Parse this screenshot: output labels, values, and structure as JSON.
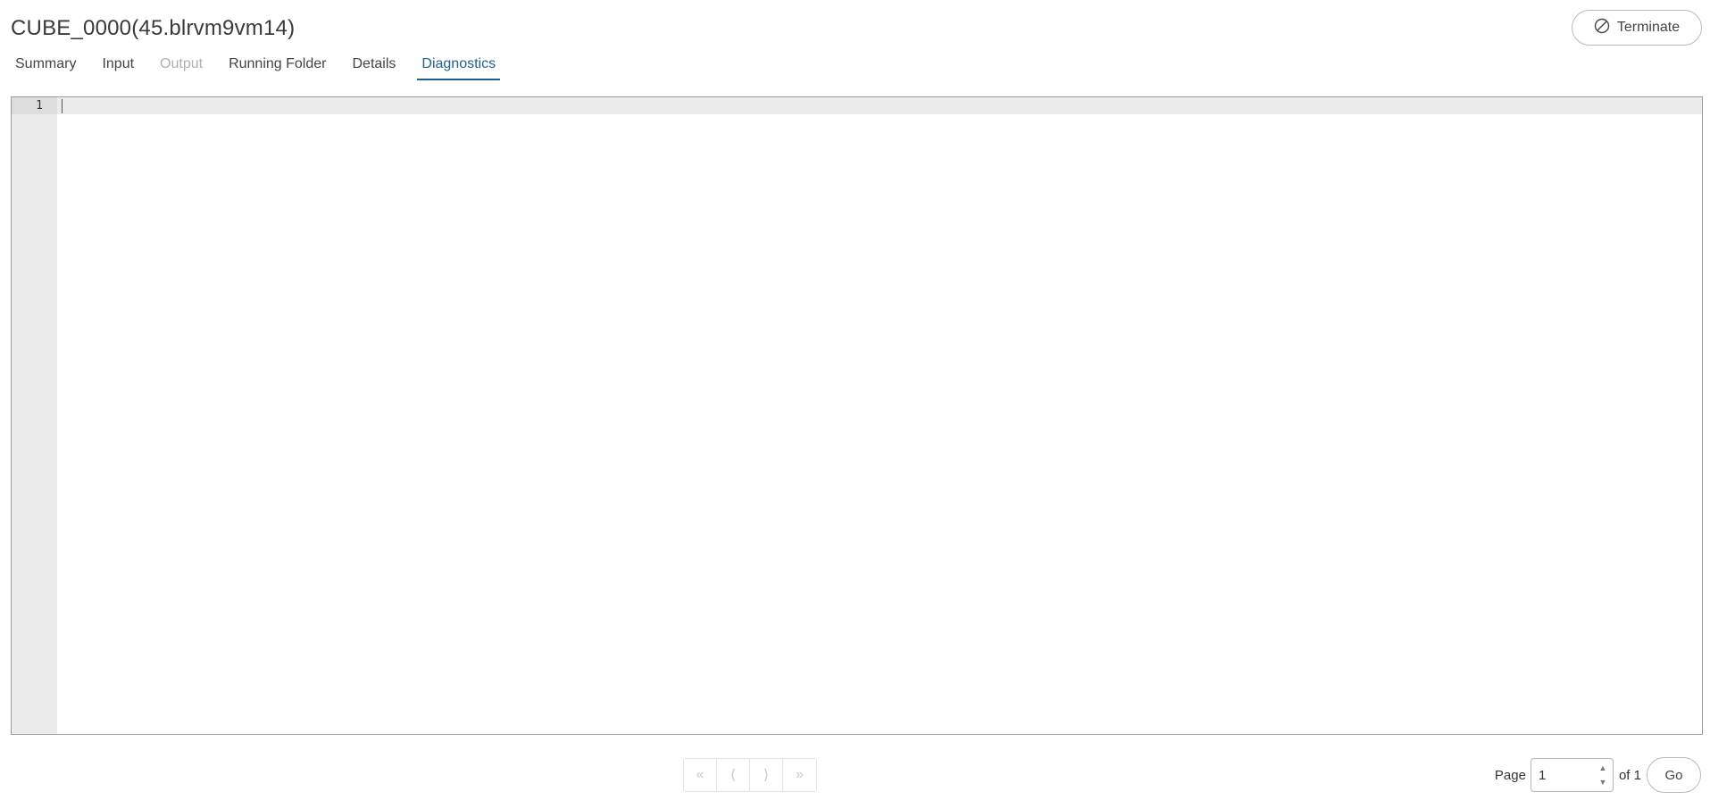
{
  "header": {
    "title": "CUBE_0000(45.blrvm9vm14)",
    "terminate_label": "Terminate",
    "terminate_icon": "circle-slash-icon"
  },
  "tabs": [
    {
      "label": "Summary",
      "state": "normal"
    },
    {
      "label": "Input",
      "state": "normal"
    },
    {
      "label": "Output",
      "state": "disabled"
    },
    {
      "label": "Running Folder",
      "state": "normal"
    },
    {
      "label": "Details",
      "state": "normal"
    },
    {
      "label": "Diagnostics",
      "state": "active"
    }
  ],
  "editor": {
    "line_numbers": [
      "1"
    ],
    "content": ""
  },
  "pagination": {
    "first_glyph": "«",
    "prev_glyph": "⟨",
    "next_glyph": "⟩",
    "last_glyph": "»",
    "page_label": "Page",
    "page_value": "1",
    "of_label": "of 1",
    "go_label": "Go"
  },
  "colors": {
    "accent": "#1f5f8b",
    "disabled_tab": "#b0b0b0",
    "gutter": "#ebebeb"
  }
}
